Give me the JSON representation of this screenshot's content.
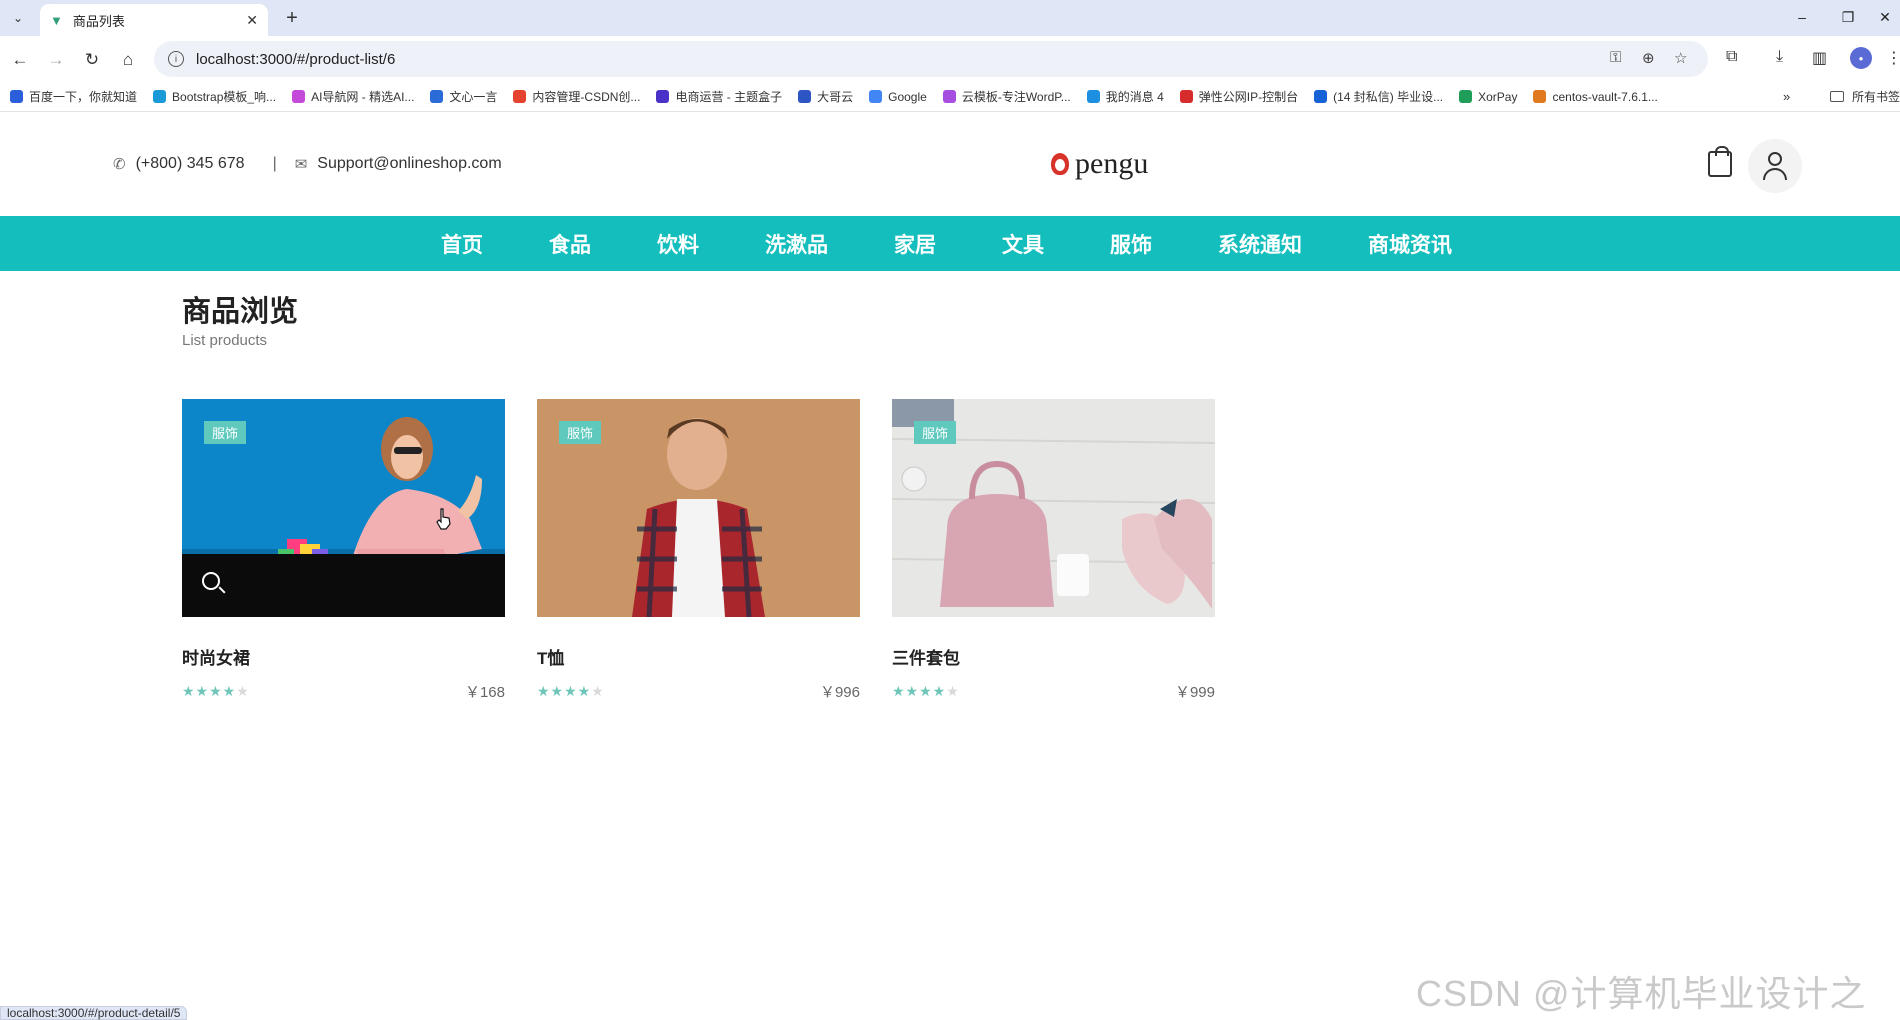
{
  "browser": {
    "tab_title": "商品列表",
    "url": "localhost:3000/#/product-list/6",
    "bookmarks": [
      {
        "label": "百度一下，你就知道",
        "color": "#2b5fd9"
      },
      {
        "label": "Bootstrap模板_响...",
        "color": "#1a9ad6"
      },
      {
        "label": "AI导航网 - 精选AI...",
        "color": "#c44bd9"
      },
      {
        "label": "文心一言",
        "color": "#2a6bd8"
      },
      {
        "label": "内容管理-CSDN创...",
        "color": "#e5432f"
      },
      {
        "label": "电商运营 - 主题盒子",
        "color": "#4a32c8"
      },
      {
        "label": "大哥云",
        "color": "#2d55c4"
      },
      {
        "label": "Google",
        "color": "#4285f4"
      },
      {
        "label": "云模板-专注WordP...",
        "color": "#a64ee0"
      },
      {
        "label": "我的消息 4",
        "color": "#1d8fe0"
      },
      {
        "label": "弹性公网IP-控制台",
        "color": "#d62c2c"
      },
      {
        "label": "(14 封私信) 毕业设...",
        "color": "#1662d6"
      },
      {
        "label": "XorPay",
        "color": "#1e9e58"
      },
      {
        "label": "centos-vault-7.6.1...",
        "color": "#e07a1f"
      }
    ],
    "all_bookmarks_label": "所有书签",
    "status_url": "localhost:3000/#/product-detail/5"
  },
  "header": {
    "phone": "(+800) 345 678",
    "separator": "|",
    "email": "Support@onlineshop.com",
    "logo_text": "pengu"
  },
  "nav": [
    "首页",
    "食品",
    "饮料",
    "洗漱品",
    "家居",
    "文具",
    "服饰",
    "系统通知",
    "商城资讯"
  ],
  "page": {
    "title": "商品浏览",
    "subtitle": "List products"
  },
  "products": [
    {
      "name": "时尚女裙",
      "category": "服饰",
      "price": "￥168",
      "rating": 4
    },
    {
      "name": "T恤",
      "category": "服饰",
      "price": "￥996",
      "rating": 4
    },
    {
      "name": "三件套包",
      "category": "服饰",
      "price": "￥999",
      "rating": 4
    }
  ],
  "watermark": "CSDN @计算机毕业设计之家"
}
